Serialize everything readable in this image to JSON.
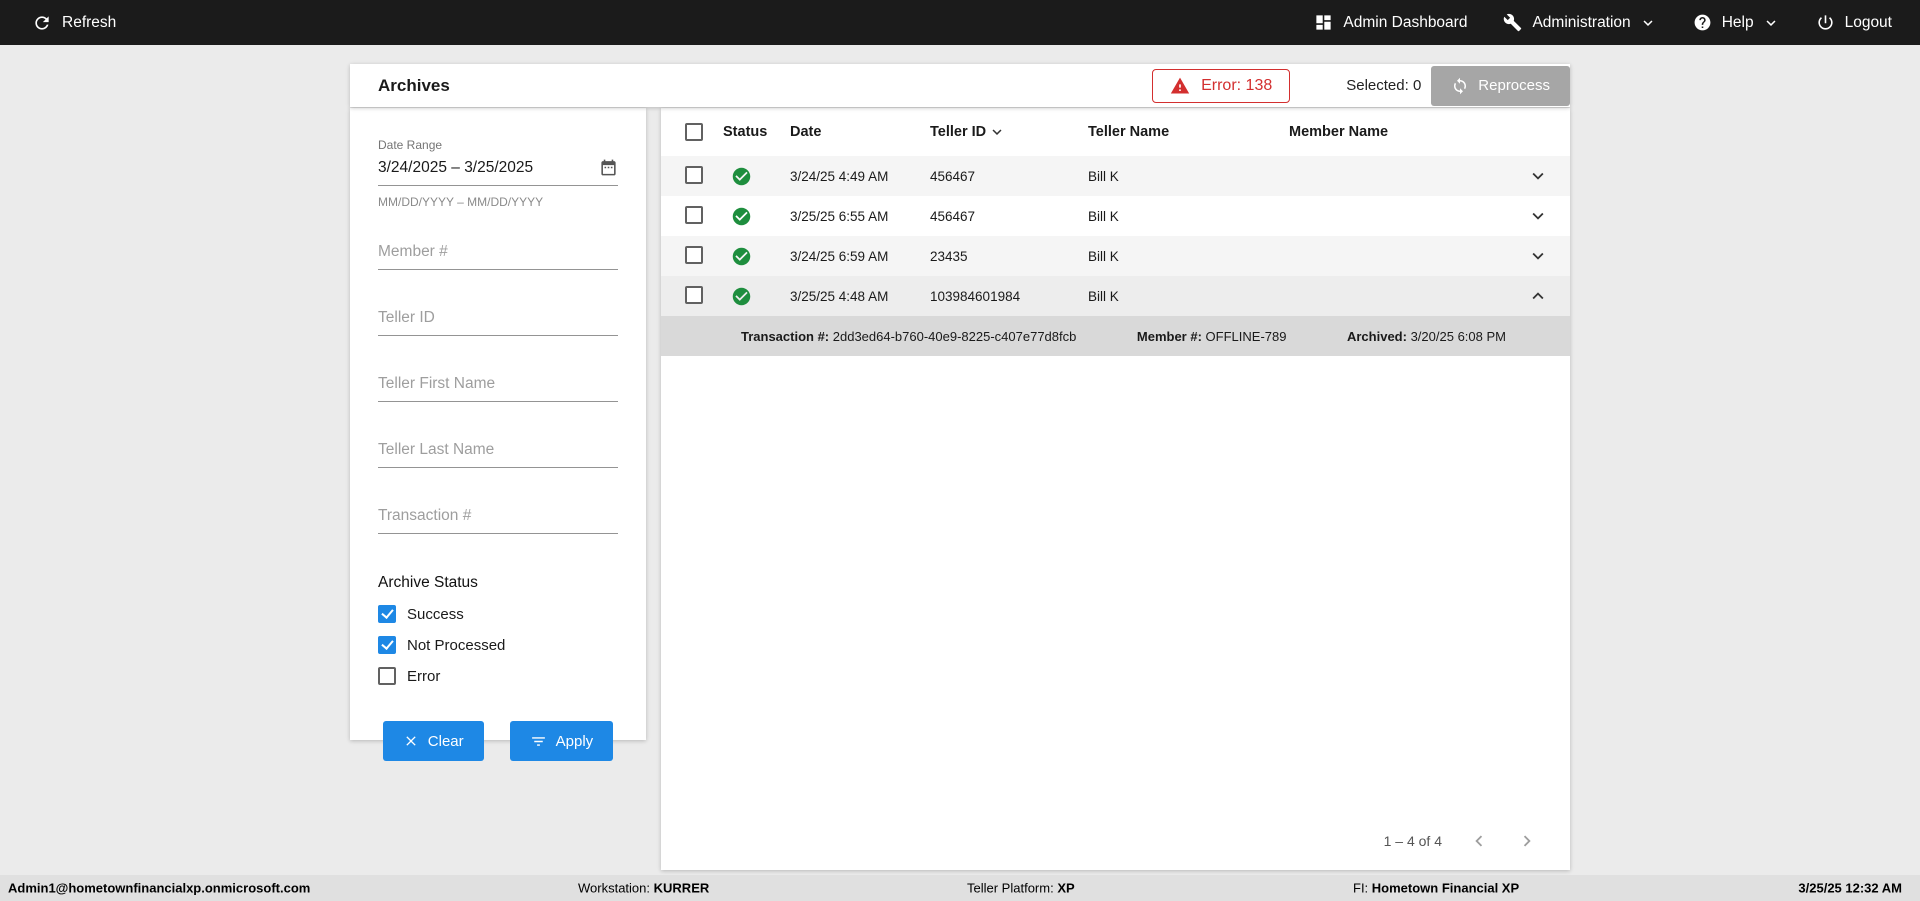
{
  "topbar": {
    "refresh_label": "Refresh",
    "admin_dashboard_label": "Admin Dashboard",
    "administration_label": "Administration",
    "help_label": "Help",
    "logout_label": "Logout"
  },
  "header": {
    "title": "Archives",
    "error_badge_label": "Error: 138",
    "selected_label": "Selected: 0",
    "reprocess_label": "Reprocess"
  },
  "filters": {
    "date_range": {
      "label": "Date Range",
      "value": "3/24/2025 – 3/25/2025",
      "helper": "MM/DD/YYYY – MM/DD/YYYY"
    },
    "member_number_placeholder": "Member #",
    "teller_id_placeholder": "Teller ID",
    "teller_first_name_placeholder": "Teller First Name",
    "teller_last_name_placeholder": "Teller Last Name",
    "transaction_number_placeholder": "Transaction #",
    "archive_status": {
      "label": "Archive Status",
      "options": [
        {
          "label": "Success",
          "checked": true
        },
        {
          "label": "Not Processed",
          "checked": true
        },
        {
          "label": "Error",
          "checked": false
        }
      ]
    },
    "clear_label": "Clear",
    "apply_label": "Apply"
  },
  "table": {
    "columns": {
      "status": "Status",
      "date": "Date",
      "teller_id": "Teller ID",
      "teller_name": "Teller Name",
      "member_name": "Member Name"
    },
    "sorted_column": "Teller ID",
    "rows": [
      {
        "status": "success",
        "date": "3/24/25 4:49 AM",
        "teller_id": "456467",
        "teller_name": "Bill K",
        "member_name": "",
        "expanded": false
      },
      {
        "status": "success",
        "date": "3/25/25 6:55 AM",
        "teller_id": "456467",
        "teller_name": "Bill K",
        "member_name": "",
        "expanded": false
      },
      {
        "status": "success",
        "date": "3/24/25 6:59 AM",
        "teller_id": "23435",
        "teller_name": "Bill K",
        "member_name": "",
        "expanded": false
      },
      {
        "status": "success",
        "date": "3/25/25 4:48 AM",
        "teller_id": "103984601984",
        "teller_name": "Bill K",
        "member_name": "",
        "expanded": true
      }
    ],
    "expanded_detail": {
      "transaction_label": "Transaction #:",
      "transaction_value": "2dd3ed64-b760-40e9-8225-c407e77d8fcb",
      "member_label": "Member #:",
      "member_value": "OFFLINE-789",
      "archived_label": "Archived:",
      "archived_value": "3/20/25 6:08 PM"
    },
    "pagination": {
      "range_label": "1 – 4 of 4"
    }
  },
  "footer": {
    "user": "Admin1@hometownfinancialxp.onmicrosoft.com",
    "workstation_label": "Workstation:",
    "workstation_value": "KURRER",
    "platform_label": "Teller Platform:",
    "platform_value": "XP",
    "fi_label": "FI:",
    "fi_value": "Hometown Financial XP",
    "datetime": "3/25/25 12:32 AM"
  },
  "colors": {
    "topbar_bg": "#1b1b1b",
    "page_bg": "#ebebeb",
    "accent_blue": "#1e88e5",
    "error_red": "#d32f2f",
    "success_green": "#1e8e3e"
  },
  "icons": {
    "refresh": "circular-arrow",
    "admin_dashboard": "grid-squares",
    "administration": "wrench",
    "help": "question-circle",
    "logout": "power",
    "dropdown": "chevron-down",
    "error_badge": "warning-triangle",
    "reprocess": "sync-arrows",
    "date_range": "calendar",
    "clear": "x-mark",
    "apply": "filter-lines",
    "status_success": "check-circle",
    "row_expand": "chevron-down",
    "sort": "chevron-down",
    "page_prev": "chevron-left",
    "page_next": "chevron-right"
  }
}
